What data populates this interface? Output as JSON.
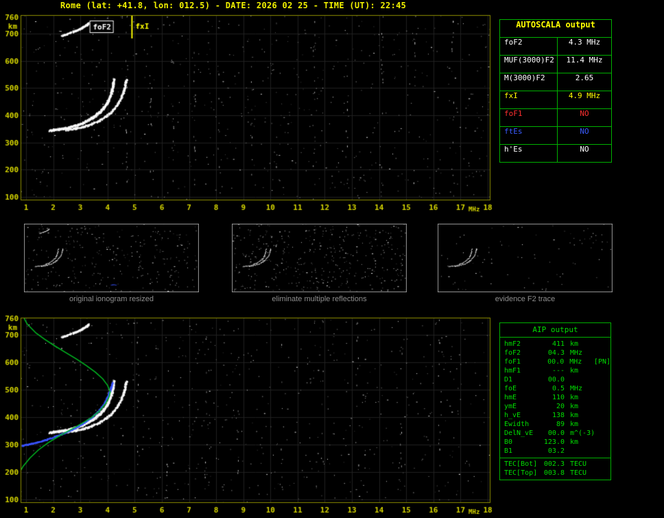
{
  "header": {
    "title": "Rome (lat: +41.8, lon: 012.5) - DATE: 2026 02 25 - TIME (UT): 22:45"
  },
  "autoscala": {
    "title": "AUTOSCALA output",
    "rows": [
      {
        "label": "foF2",
        "value": "4.3 MHz",
        "color": "#ffffff"
      },
      {
        "label": "MUF(3000)F2",
        "value": "11.4 MHz",
        "color": "#ffffff"
      },
      {
        "label": "M(3000)F2",
        "value": "2.65",
        "color": "#ffffff"
      },
      {
        "label": "fxI",
        "value": "4.9 MHz",
        "color": "#ffff00"
      },
      {
        "label": "foF1",
        "value": "NO",
        "color": "#ff3030"
      },
      {
        "label": "ftEs",
        "value": "NO",
        "color": "#3a5cff"
      },
      {
        "label": "h'Es",
        "value": "NO",
        "color": "#ffffff"
      }
    ]
  },
  "aip": {
    "title": "AIP output",
    "rows": [
      {
        "label": "hmF2",
        "value": "411",
        "unit": "km"
      },
      {
        "label": "foF2",
        "value": "04.3",
        "unit": "MHz"
      },
      {
        "label": "foF1",
        "value": "00.0",
        "unit": "MHz",
        "note": "[PN]"
      },
      {
        "label": "hmF1",
        "value": "---",
        "unit": "km"
      },
      {
        "label": "D1",
        "value": "00.0",
        "unit": ""
      },
      {
        "label": "foE",
        "value": "0.5",
        "unit": "MHz"
      },
      {
        "label": "hmE",
        "value": "110",
        "unit": "km"
      },
      {
        "label": "ymE",
        "value": "20",
        "unit": "km"
      },
      {
        "label": "h_vE",
        "value": "138",
        "unit": "km"
      },
      {
        "label": "Ewidth",
        "value": "89",
        "unit": "km"
      },
      {
        "label": "DelN_vE",
        "value": "00.0",
        "unit": "m^(-3)"
      },
      {
        "label": "B0",
        "value": "123.0",
        "unit": "km"
      },
      {
        "label": "B1",
        "value": "03.2",
        "unit": ""
      }
    ],
    "tec_rows": [
      {
        "label": "TEC[Bot]",
        "value": "002.3",
        "unit": "TECU"
      },
      {
        "label": "TEC[Top]",
        "value": "003.8",
        "unit": "TECU"
      }
    ]
  },
  "thumbnails": [
    {
      "caption": "original ionogram resized"
    },
    {
      "caption": "eliminate multiple reflections"
    },
    {
      "caption": "evidence F2 trace"
    }
  ],
  "chart_data": [
    {
      "id": "main-ionogram",
      "type": "scatter",
      "panel": "top",
      "title": "scaled ionogram with AUTOSCALA annotations",
      "xlabel": "MHz",
      "ylabel": "km",
      "xlim": [
        0.8,
        18.1
      ],
      "ylim": [
        90,
        770
      ],
      "x_ticks": [
        1,
        2,
        3,
        4,
        5,
        6,
        7,
        8,
        9,
        10,
        11,
        12,
        13,
        14,
        15,
        16,
        17,
        18
      ],
      "y_ticks": [
        760,
        700,
        600,
        500,
        400,
        300,
        200,
        100
      ],
      "y_grid": [
        100,
        200,
        300,
        400,
        500,
        600,
        700
      ],
      "grid": true,
      "annotations": [
        {
          "label": "foF2",
          "freq_mhz": 4.3,
          "color": "#ffffff",
          "style": "boxed-label"
        },
        {
          "label": "fxI",
          "freq_mhz": 4.9,
          "color": "#ffff00",
          "style": "vertical-line"
        }
      ],
      "series": [
        {
          "name": "F2-trace-ordinary",
          "color": "#ffffff",
          "passes": 3,
          "size": 2,
          "jitter": 1.5,
          "points": [
            [
              1.85,
              346
            ],
            [
              2.1,
              349
            ],
            [
              2.4,
              353
            ],
            [
              2.7,
              360
            ],
            [
              3.0,
              370
            ],
            [
              3.25,
              382
            ],
            [
              3.5,
              397
            ],
            [
              3.72,
              415
            ],
            [
              3.9,
              436
            ],
            [
              4.03,
              458
            ],
            [
              4.12,
              482
            ],
            [
              4.18,
              508
            ],
            [
              4.22,
              536
            ]
          ]
        },
        {
          "name": "F2-trace-extraordinary",
          "color": "#ffffff",
          "passes": 2,
          "size": 2,
          "jitter": 1.3,
          "points": [
            [
              2.45,
              348
            ],
            [
              2.75,
              352
            ],
            [
              3.05,
              358
            ],
            [
              3.35,
              367
            ],
            [
              3.62,
              379
            ],
            [
              3.88,
              394
            ],
            [
              4.1,
              412
            ],
            [
              4.3,
              434
            ],
            [
              4.45,
              458
            ],
            [
              4.56,
              484
            ],
            [
              4.63,
              510
            ],
            [
              4.68,
              536
            ]
          ]
        },
        {
          "name": "second-hop-echo",
          "color": "#ffffff",
          "passes": 2,
          "size": 2,
          "jitter": 1.2,
          "points": [
            [
              2.3,
              694
            ],
            [
              2.55,
              702
            ],
            [
              2.8,
              711
            ],
            [
              3.0,
              720
            ],
            [
              3.2,
              732
            ],
            [
              3.3,
              740
            ]
          ]
        }
      ],
      "noise": {
        "seed": 7,
        "count": 650,
        "rfi_columns": [
          4.7,
          5.6,
          6.4,
          7.2,
          8.1,
          9.3,
          10.2,
          11.6,
          12.8,
          14.1,
          15.3,
          16.7
        ]
      }
    },
    {
      "id": "profile-ionogram",
      "type": "scatter",
      "panel": "bottom",
      "title": "ionogram with restored trace and electron density profile",
      "xlabel": "MHz",
      "ylabel": "km",
      "xlim": [
        0.8,
        18.1
      ],
      "ylim": [
        90,
        770
      ],
      "x_ticks": [
        1,
        2,
        3,
        4,
        5,
        6,
        7,
        8,
        9,
        10,
        11,
        12,
        13,
        14,
        15,
        16,
        17,
        18
      ],
      "y_ticks": [
        760,
        700,
        600,
        500,
        400,
        300,
        200,
        100
      ],
      "y_grid": [
        100,
        200,
        300,
        400,
        500,
        600,
        700
      ],
      "grid": true,
      "from": "main-ionogram",
      "use_series": [
        "F2-trace-ordinary",
        "F2-trace-extraordinary",
        "second-hop-echo"
      ],
      "extra_series": [
        {
          "name": "restored-true-height-trace",
          "color": "#3b55ff",
          "passes": 2,
          "size": 2,
          "jitter": 0.8,
          "points": [
            [
              0.82,
              298
            ],
            [
              1.1,
              303
            ],
            [
              1.4,
              310
            ],
            [
              1.75,
              320
            ],
            [
              2.1,
              332
            ],
            [
              2.45,
              346
            ],
            [
              2.8,
              362
            ],
            [
              3.1,
              380
            ],
            [
              3.4,
              400
            ],
            [
              3.65,
              424
            ],
            [
              3.85,
              450
            ],
            [
              4.0,
              478
            ],
            [
              4.1,
              505
            ],
            [
              4.17,
              530
            ]
          ]
        },
        {
          "name": "electron-density-profile",
          "color": "#00bb22",
          "render": "line",
          "points": [
            [
              0.72,
              192
            ],
            [
              0.9,
              222
            ],
            [
              1.15,
              252
            ],
            [
              1.45,
              280
            ],
            [
              1.8,
              306
            ],
            [
              2.2,
              330
            ],
            [
              2.6,
              352
            ],
            [
              3.0,
              374
            ],
            [
              3.4,
              398
            ],
            [
              3.7,
              422
            ],
            [
              3.92,
              448
            ],
            [
              4.05,
              472
            ],
            [
              4.1,
              492
            ],
            [
              4.0,
              516
            ],
            [
              3.82,
              540
            ],
            [
              3.55,
              564
            ],
            [
              3.22,
              588
            ],
            [
              2.85,
              612
            ],
            [
              2.45,
              636
            ],
            [
              2.05,
              660
            ],
            [
              1.68,
              684
            ],
            [
              1.35,
              708
            ],
            [
              1.05,
              738
            ],
            [
              0.95,
              756
            ],
            [
              0.9,
              770
            ]
          ]
        }
      ],
      "noise": {
        "seed": 19,
        "count": 650,
        "rfi_columns": [
          5.1,
          6.2,
          7.6,
          8.8,
          10.4,
          11.9,
          13.2,
          14.8,
          16.2
        ]
      }
    },
    {
      "id": "thumb-original",
      "type": "scatter",
      "panel": "thumbnail-1",
      "from": "main-ionogram",
      "use_series": [
        "F2-trace-ordinary",
        "F2-trace-extraordinary",
        "second-hop-echo"
      ],
      "extra_series": [
        {
          "name": "restored-trace-mark",
          "color": "#3b55ff",
          "passes": 1,
          "size": 1,
          "jitter": 0.6,
          "points": [
            [
              9.6,
              150
            ],
            [
              9.9,
              155
            ],
            [
              10.2,
              148
            ]
          ]
        }
      ],
      "noise": {
        "seed": 31,
        "count": 300
      }
    },
    {
      "id": "thumb-clean",
      "type": "scatter",
      "panel": "thumbnail-2",
      "from": "main-ionogram",
      "use_series": [
        "F2-trace-ordinary",
        "F2-trace-extraordinary"
      ],
      "noise": {
        "seed": 47,
        "count": 430
      }
    },
    {
      "id": "thumb-f2",
      "type": "scatter",
      "panel": "thumbnail-3",
      "from": "main-ionogram",
      "use_series": [
        "F2-trace-ordinary",
        "F2-trace-extraordinary"
      ],
      "noise": {
        "seed": 61,
        "count": 90
      }
    }
  ]
}
